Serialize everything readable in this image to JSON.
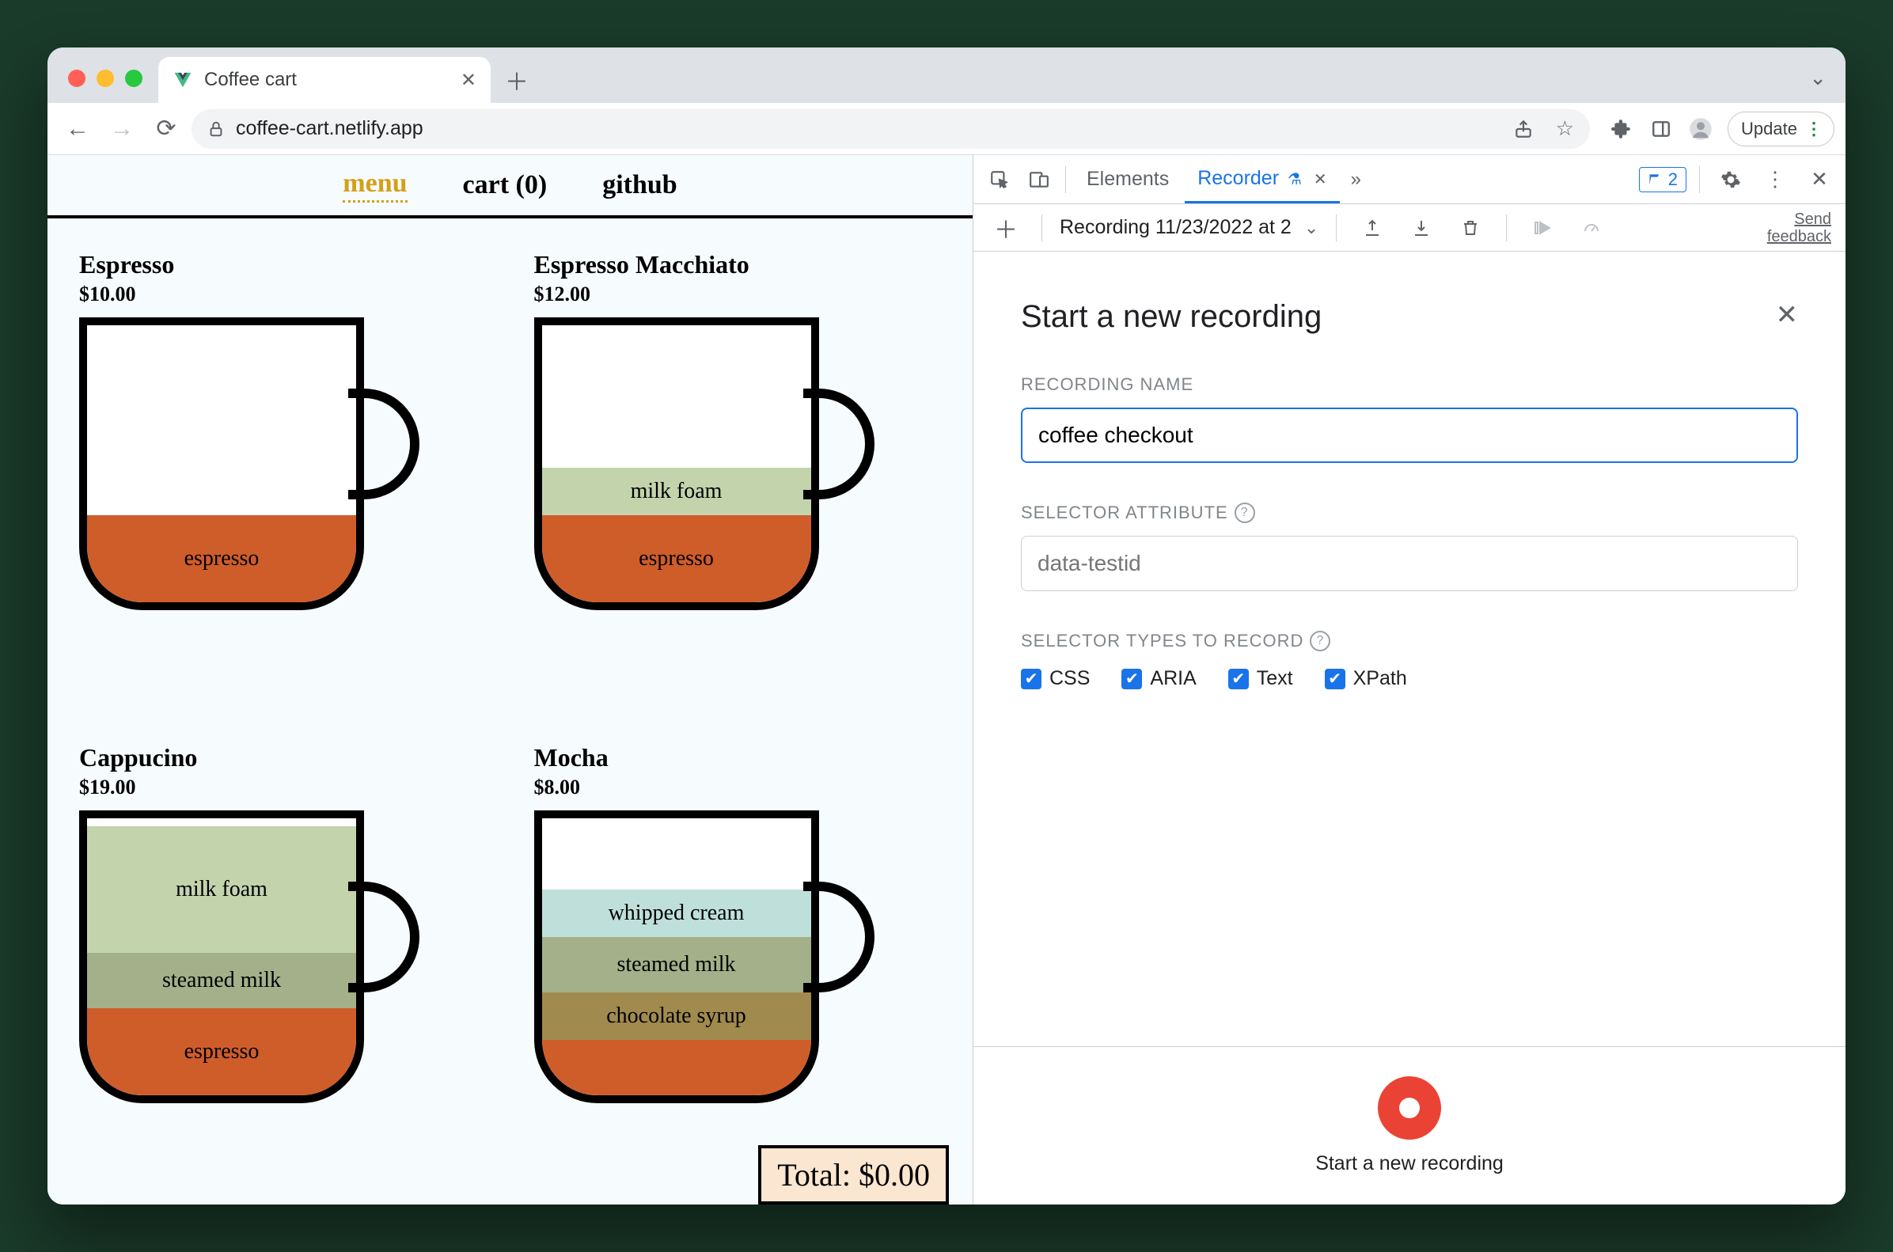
{
  "browser": {
    "tab_title": "Coffee cart",
    "url": "coffee-cart.netlify.app",
    "update_label": "Update"
  },
  "site": {
    "nav": {
      "menu": "menu",
      "cart": "cart (0)",
      "github": "github"
    },
    "items": [
      {
        "name": "Espresso",
        "price": "$10.00"
      },
      {
        "name": "Espresso Macchiato",
        "price": "$12.00"
      },
      {
        "name": "Cappucino",
        "price": "$19.00"
      },
      {
        "name": "Mocha",
        "price": "$8.00"
      }
    ],
    "layers": {
      "espresso": "espresso",
      "milk_foam": "milk foam",
      "steamed_milk": "steamed milk",
      "whipped_cream": "whipped cream",
      "chocolate_syrup": "chocolate syrup"
    },
    "total_label": "Total: $0.00"
  },
  "devtools": {
    "tabs": {
      "elements": "Elements",
      "recorder": "Recorder"
    },
    "issues_count": "2",
    "toolbar": {
      "recording_name": "Recording 11/23/2022 at 2",
      "feedback1": "Send",
      "feedback2": "feedback"
    },
    "panel": {
      "title": "Start a new recording",
      "recording_name_label": "RECORDING NAME",
      "recording_name_value": "coffee checkout",
      "selector_attr_label": "SELECTOR ATTRIBUTE",
      "selector_attr_placeholder": "data-testid",
      "selector_types_label": "SELECTOR TYPES TO RECORD",
      "types": {
        "css": "CSS",
        "aria": "ARIA",
        "text": "Text",
        "xpath": "XPath"
      }
    },
    "footer_label": "Start a new recording"
  }
}
